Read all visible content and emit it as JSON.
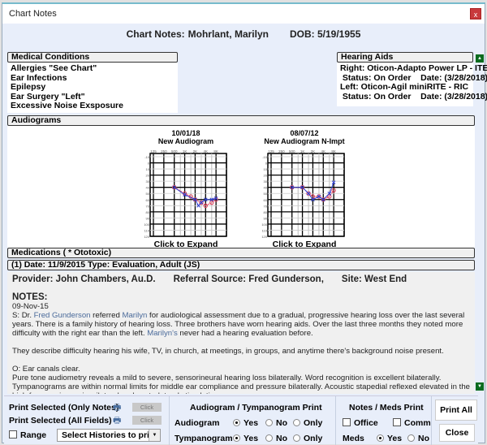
{
  "window": {
    "title": "Chart Notes",
    "close_icon": "close-icon"
  },
  "header": {
    "label": "Chart Notes:",
    "patient": "Mohrlant, Marilyn",
    "dob": "DOB: 5/19/1955"
  },
  "medical_conditions": {
    "title": "Medical Conditions",
    "items": [
      "Allergies \"See Chart\"",
      "Ear Infections",
      "Epilepsy",
      "Ear Surgery \"Left\"",
      "Excessive Noise Exsposure"
    ]
  },
  "hearing_aids": {
    "title": "Hearing Aids",
    "lines": [
      "Right: Oticon-Adapto Power LP - ITE",
      " Status: On Order    Date: (3/28/2018)",
      "Left: Oticon-Agil miniRITE - RIC",
      " Status: On Order    Date: (3/28/2018)"
    ]
  },
  "audiograms": {
    "title": "Audiograms",
    "expand_label": "Click to Expand",
    "freq_labels": [
      "125",
      "250",
      "500",
      "1K",
      "2K",
      "4K",
      "8K"
    ],
    "colors": {
      "right": "#e0405a",
      "left": "#3040d0"
    },
    "items": [
      {
        "date": "10/01/18",
        "name": "New Audiogram",
        "right": [
          [
            500,
            40
          ],
          [
            1000,
            50
          ],
          [
            1500,
            55
          ],
          [
            2000,
            60
          ],
          [
            3000,
            65
          ],
          [
            4000,
            70
          ],
          [
            6000,
            65
          ],
          [
            8000,
            60
          ]
        ],
        "left": [
          [
            500,
            40
          ],
          [
            1000,
            52
          ],
          [
            2000,
            60
          ],
          [
            2500,
            70
          ],
          [
            3000,
            65
          ],
          [
            4000,
            60
          ],
          [
            6000,
            60
          ],
          [
            8000,
            58
          ]
        ]
      },
      {
        "date": "08/07/12",
        "name": "New Audiogram N-Impt",
        "right": [
          [
            500,
            40
          ],
          [
            1000,
            40
          ],
          [
            1500,
            50
          ],
          [
            2000,
            55
          ],
          [
            3000,
            55
          ],
          [
            4000,
            60
          ],
          [
            6000,
            55
          ],
          [
            8000,
            45
          ]
        ],
        "left": [
          [
            500,
            40
          ],
          [
            1000,
            40
          ],
          [
            1500,
            50
          ],
          [
            2000,
            60
          ],
          [
            3000,
            55
          ],
          [
            4000,
            60
          ],
          [
            6000,
            50
          ],
          [
            8000,
            32
          ]
        ]
      }
    ]
  },
  "medications": {
    "title": "Medications  ( * Ototoxic)"
  },
  "record": {
    "title": "(1)  Date: 11/9/2015  Type: Evaluation, Adult  (JS)",
    "provider": "Provider: John Chambers, Au.D.",
    "referral": "Referral Source: Fred Gunderson,",
    "site": "Site: West End",
    "notes_label": "NOTES:",
    "notes_date": "09-Nov-15",
    "s1": "S:  Dr. ",
    "s1_hl": "Fred Gunderson",
    "s2": " referred ",
    "s2_hl": "Marilyn",
    "s3": " for audiological assessment due to a gradual, progressive hearing loss over the last several years.  There is a family history of hearing loss.  Three brothers have worn hearing aids.  Over the last three months they noted more difficulty with the right ear than the left.  ",
    "s3_hl": "Marilyn's",
    "s4": " never had a hearing evaluation before.",
    "p2": "They describe difficulty hearing his wife, TV, in church, at meetings, in groups, and anytime there's background noise present.",
    "o1": "O:  Ear canals clear.",
    "o2": "Pure tone audiometry reveals a mild to severe, sensorineural hearing loss bilaterally.  Word recognition is excellent bilaterally.  Tympanograms are within normal limits for middle ear compliance and pressure bilaterally.  Acoustic stapedial reflexed elevated in the high frequencies on ispsilateral and contralateral stimulation."
  },
  "print": {
    "only_notes": "Print Selected (Only Notes)",
    "all_fields": "Print Selected (All Fields)",
    "click": "Click",
    "range": "Range",
    "select_histories": "Select Histories to print",
    "aud_title": "Audiogram / Tympanogram Print",
    "audiogram": "Audiogram",
    "tympanogram": "Tympanogram",
    "yes": "Yes",
    "no": "No",
    "only": "Only",
    "audiogram_selected": "Yes",
    "tympanogram_selected": "Yes",
    "notes_title": "Notes / Meds Print",
    "office": "Office",
    "comm": "Comm",
    "meds": "Meds",
    "meds_selected": "Yes",
    "print_all": "Print All",
    "close": "Close"
  }
}
